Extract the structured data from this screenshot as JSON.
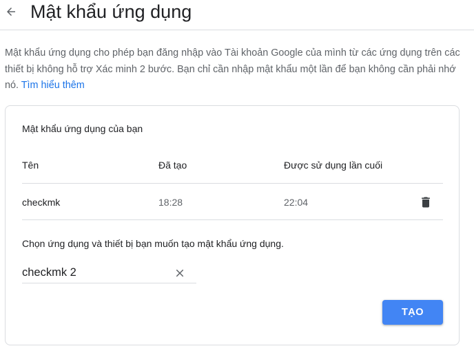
{
  "header": {
    "title": "Mật khẩu ứng dụng",
    "back_icon": "arrow-back-icon"
  },
  "description": {
    "text": "Mật khẩu ứng dụng cho phép bạn đăng nhập vào Tài khoản Google của mình từ các ứng dụng trên các thiết bị không hỗ trợ Xác minh 2 bước. Bạn chỉ cần nhập mật khẩu một lần để bạn không cần phải nhớ nó.",
    "link_label": "Tìm hiểu thêm"
  },
  "card": {
    "title": "Mật khẩu ứng dụng của bạn",
    "columns": {
      "name": "Tên",
      "created": "Đã tạo",
      "last_used": "Được sử dụng lần cuối"
    },
    "rows": [
      {
        "name": "checkmk",
        "created": "18:28",
        "last_used": "22:04",
        "action_icon": "trash-icon"
      }
    ],
    "prompt": "Chọn ứng dụng và thiết bị bạn muốn tạo mật khẩu ứng dụng.",
    "input": {
      "value": "checkmk 2",
      "clear_icon": "close-icon"
    },
    "create_label": "TẠO"
  },
  "colors": {
    "accent": "#4285f4",
    "link": "#1a73e8",
    "text_primary": "#202124",
    "text_secondary": "#5f6368",
    "divider": "#dadce0"
  }
}
